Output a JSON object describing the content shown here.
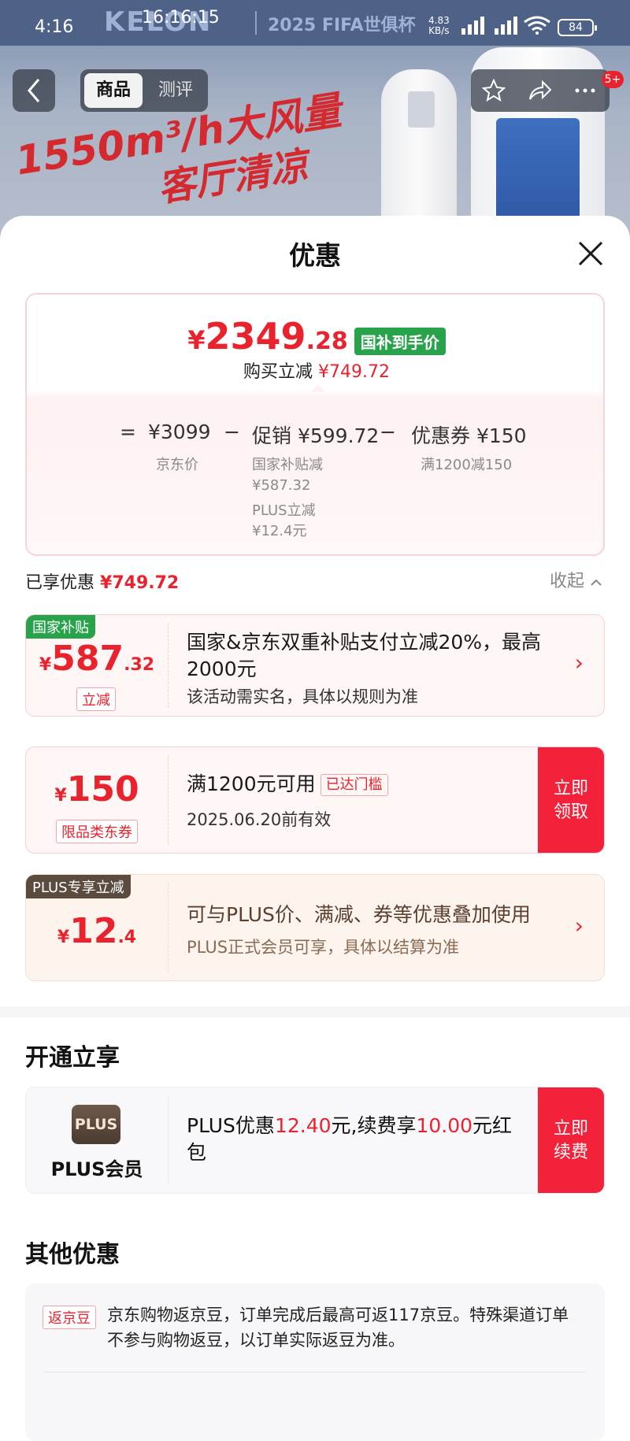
{
  "status_bar": {
    "time": "4:16",
    "clock_overlay": "16:16:15",
    "net_speed_value": "4.83",
    "net_speed_unit": "KB/s",
    "battery": "84"
  },
  "banner": {
    "brand": "KELON",
    "campaign": "2025 FIFA世俱杯",
    "ad_line1": "1550m³/h大风量",
    "ad_line2": "客厅清凉"
  },
  "nav": {
    "tab_product": "商品",
    "tab_review": "测评",
    "badge": "5+"
  },
  "sheet": {
    "title": "优惠"
  },
  "price_card": {
    "currency": "¥",
    "price_int": "2349",
    "price_dec": ".28",
    "price_tag": "国补到手价",
    "sub_prefix": "购买立减",
    "sub_amount": "¥749.72",
    "eq": "=",
    "base": "¥3099",
    "minus1": "−",
    "promo": "促销 ¥599.72",
    "minus2": "−",
    "coupon": "优惠券 ¥150",
    "base_label": "京东价",
    "promo_detail1": "国家补贴减",
    "promo_detail1_value": "¥587.32",
    "promo_detail2": "PLUS立减",
    "promo_detail2_value": "¥12.4元",
    "coupon_label": "满1200减150"
  },
  "enjoyed": {
    "label": "已享优惠",
    "amount": "¥749.72",
    "collapse": "收起"
  },
  "coupons": [
    {
      "tag": "国家补贴",
      "currency": "¥",
      "amount_int": "587",
      "amount_dec": ".32",
      "box_label": "立减",
      "main": "国家&京东双重补贴支付立减20%，最高2000元",
      "sub": "该活动需实名，具体以规则为准"
    },
    {
      "currency": "¥",
      "amount_int": "150",
      "box_label": "限品类东券",
      "main": "满1200元可用",
      "met": "已达门槛",
      "sub": "2025.06.20前有效",
      "button": "立即领取"
    },
    {
      "tag": "PLUS专享立减",
      "currency": "¥",
      "amount_int": "12",
      "amount_dec": ".4",
      "main": "可与PLUS价、满减、券等优惠叠加使用",
      "sub": "PLUS正式会员可享，具体以结算为准"
    }
  ],
  "open_section": {
    "title": "开通立享",
    "logo": "PLUS",
    "name": "PLUS会员",
    "text_1": "PLUS优惠",
    "value_1": "12.40",
    "text_2": "元,续费享",
    "value_2": "10.00",
    "text_3": "元红包",
    "button": "立即续费"
  },
  "other_section": {
    "title": "其他优惠",
    "item_tag": "返京豆",
    "item_text": "京东购物返京豆，订单完成后最高可返117京豆。特殊渠道订单不参与购物返豆，以订单实际返豆为准。"
  },
  "colors": {
    "accent_red": "#e8232e",
    "button_red": "#f3213a",
    "subsidy_green": "#29a34b",
    "plus_brown": "#5b4a3e"
  }
}
